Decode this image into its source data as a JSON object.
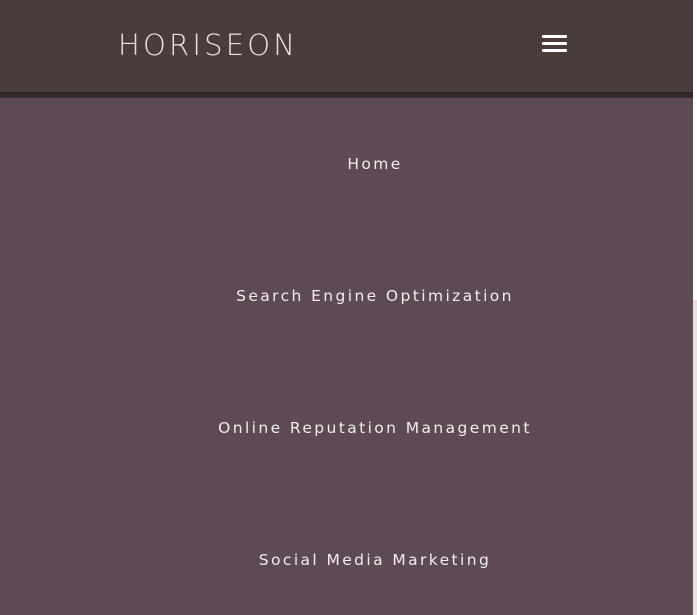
{
  "header": {
    "logo_text": "HORISEON",
    "menu_icon": "hamburger-menu-icon"
  },
  "nav": {
    "items": [
      {
        "label": "Home"
      },
      {
        "label": "Search Engine Optimization"
      },
      {
        "label": "Online Reputation Management"
      },
      {
        "label": "Social Media Marketing"
      }
    ]
  },
  "colors": {
    "header_bg": "#4b3c3c",
    "nav_bg": "#5d4a55",
    "text": "#f1ecee"
  }
}
